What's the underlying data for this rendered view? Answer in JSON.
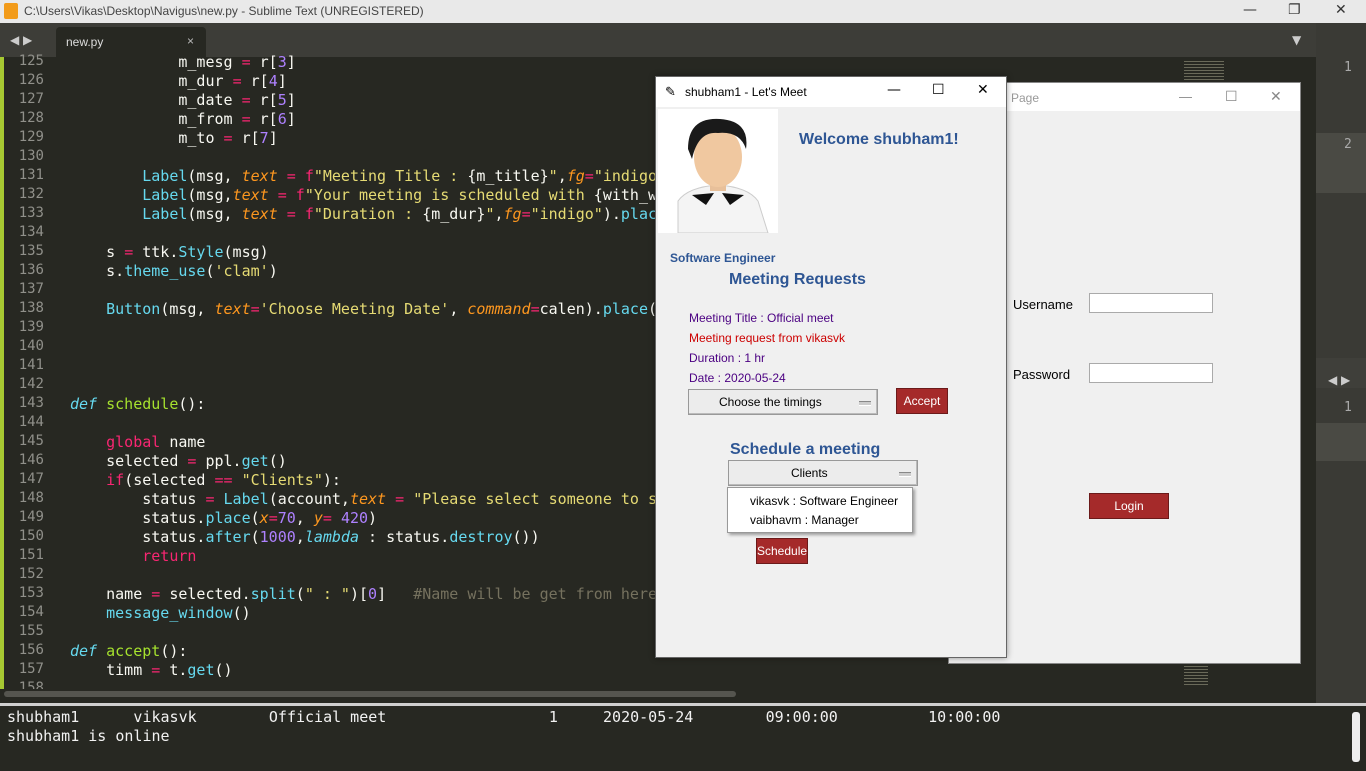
{
  "app": {
    "title": "C:\\Users\\Vikas\\Desktop\\Navigus\\new.py - Sublime Text (UNREGISTERED)",
    "tab_name": "new.py",
    "tab_close": "×"
  },
  "editor": {
    "line_numbers": [
      "125",
      "126",
      "127",
      "128",
      "129",
      "130",
      "131",
      "132",
      "133",
      "134",
      "135",
      "136",
      "137",
      "138",
      "139",
      "140",
      "141",
      "142",
      "143",
      "144",
      "145",
      "146",
      "147",
      "148",
      "149",
      "150",
      "151",
      "152",
      "153",
      "154",
      "155",
      "156",
      "157",
      "158"
    ]
  },
  "right_panel": {
    "numbers": [
      "1",
      "2",
      "1"
    ]
  },
  "console": {
    "line1": "shubham1      vikasvk        Official meet                  1     2020-05-24        09:00:00          10:00:00",
    "line2": "shubham1 is online"
  },
  "login_window": {
    "title": "Page",
    "username_label": "Username",
    "password_label": "Password",
    "login_button": "Login"
  },
  "meet_window": {
    "title": "shubham1 - Let's Meet",
    "welcome": "Welcome shubham1!",
    "role": "Software Engineer",
    "requests_heading": "Meeting Requests",
    "meeting_title": "Meeting Title : Official meet",
    "meeting_from": "Meeting request from vikasvk",
    "duration": "Duration : 1 hr",
    "date": "Date : 2020-05-24",
    "timings_placeholder": "Choose the timings",
    "accept_button": "Accept",
    "schedule_heading": "Schedule a meeting",
    "clients_combo": "Clients",
    "dropdown_options": [
      "vikasvk : Software Engineer",
      "vaibhavm : Manager"
    ],
    "schedule_button": "Schedule"
  },
  "colors": {
    "indigo": "#4b0082",
    "red": "#cc0000",
    "heading": "#2e5694",
    "button": "#a52a2a"
  }
}
